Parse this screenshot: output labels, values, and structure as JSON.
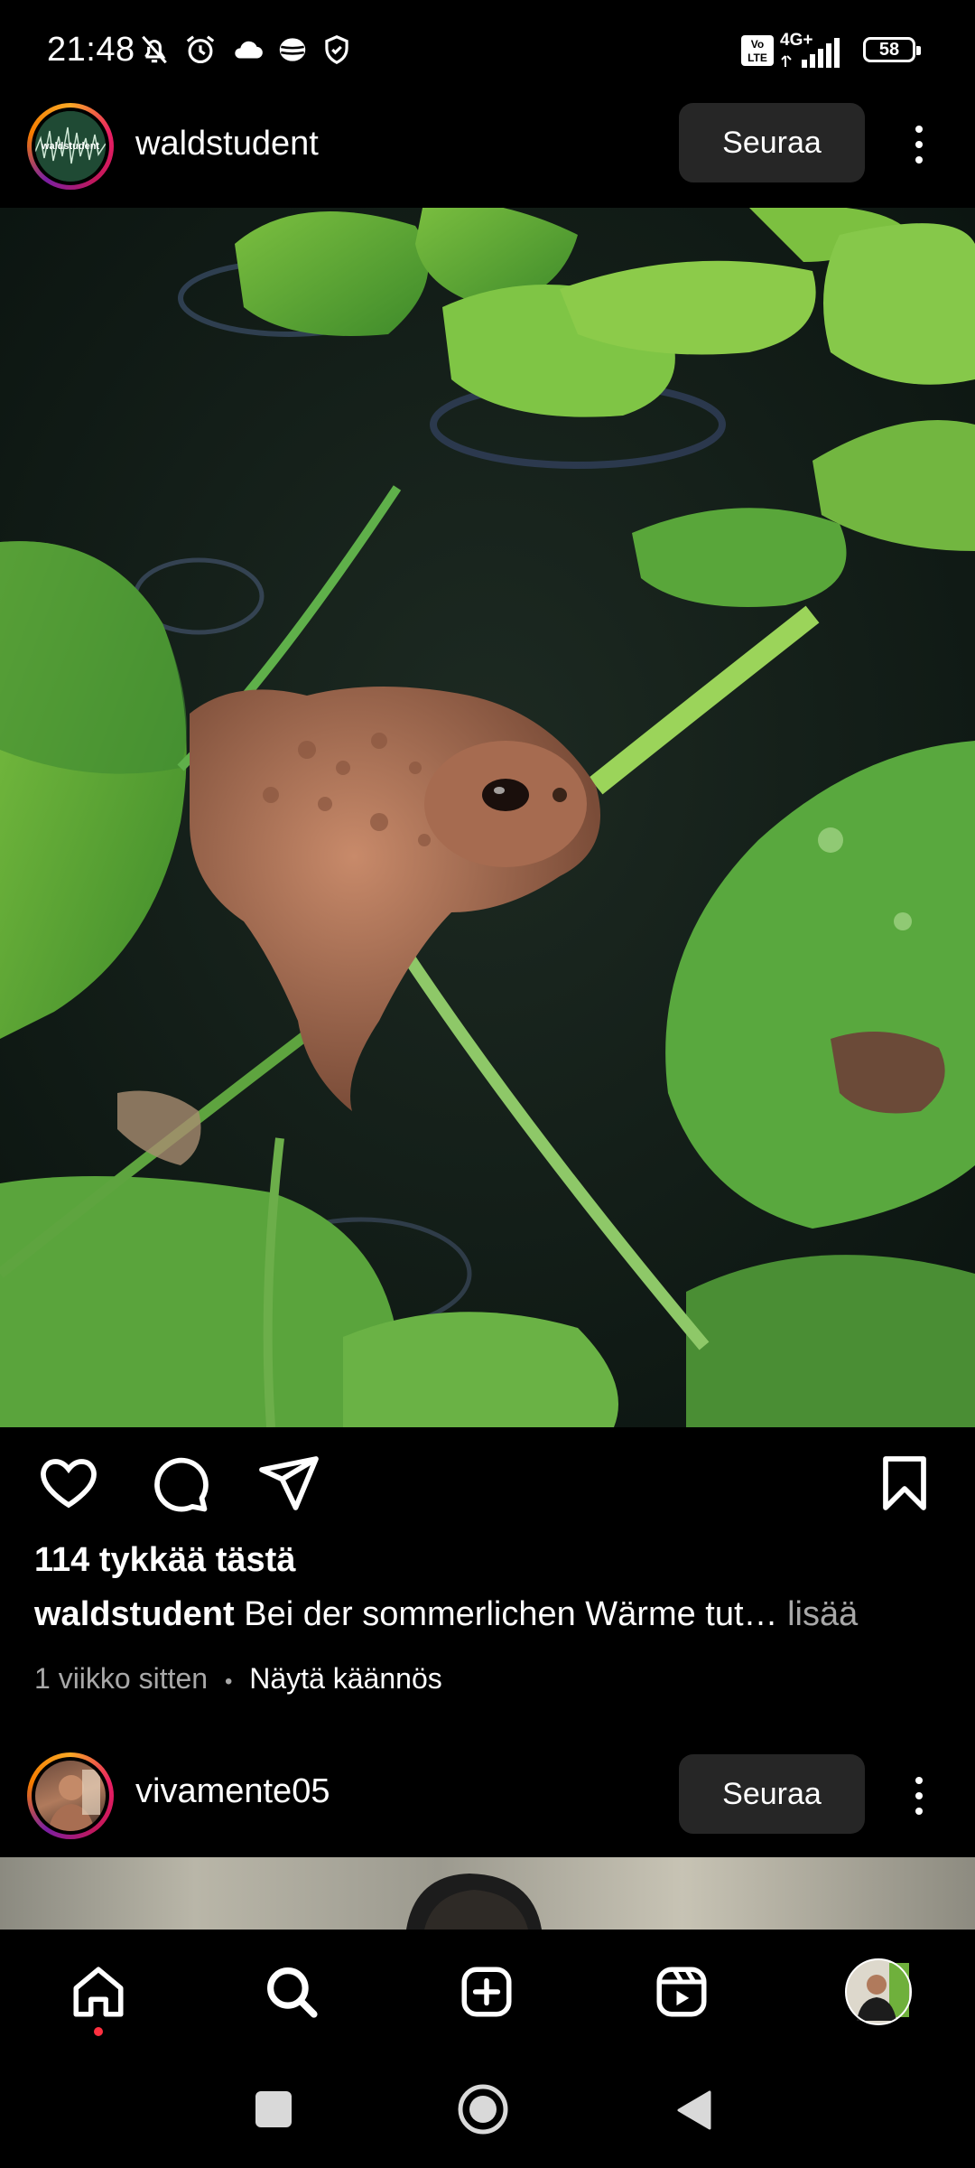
{
  "status_bar": {
    "time": "21:48",
    "battery": "58",
    "network": "4G+",
    "icons": [
      "mute-icon",
      "alarm-icon",
      "cloud-icon",
      "app-icon",
      "shield-icon",
      "volte-icon",
      "signal-icon",
      "battery-icon"
    ]
  },
  "post1": {
    "username": "waldstudent",
    "avatar_text": "waldstudent",
    "follow_label": "Seuraa",
    "image_alt": "toad in pond among lily pads",
    "likes": "114 tykkää tästä",
    "caption_user": "waldstudent",
    "caption_text": "Bei der sommerlichen Wärme tut…",
    "caption_more": "lisää",
    "time_ago": "1 viikko sitten",
    "separator": "•",
    "translate": "Näytä käännös"
  },
  "post2": {
    "username": "vivamente05",
    "follow_label": "Seuraa"
  },
  "bottom_nav": {
    "items": [
      "home-icon",
      "search-icon",
      "create-icon",
      "reels-icon",
      "profile-avatar"
    ]
  },
  "colors": {
    "background": "#000000",
    "button": "#262626",
    "muted": "#a8a8a8",
    "notification": "#ff3040"
  }
}
